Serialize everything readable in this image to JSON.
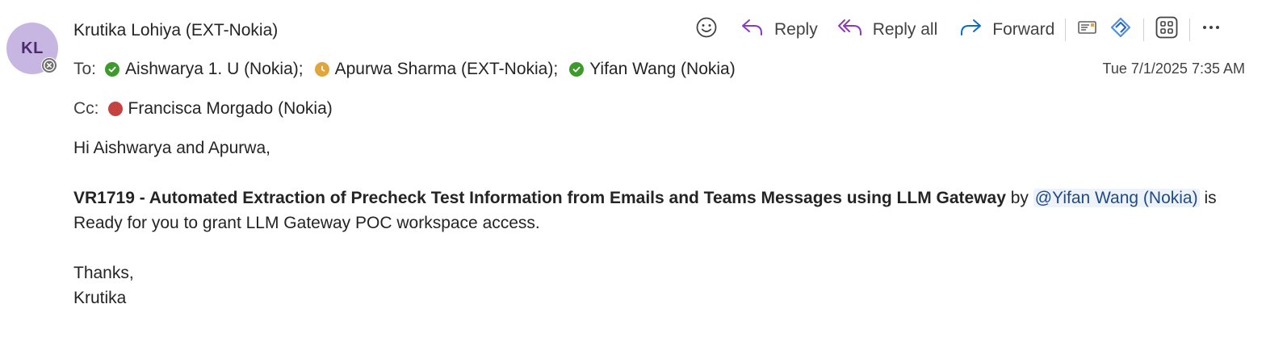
{
  "sender": {
    "initials": "KL",
    "name": "Krutika Lohiya (EXT-Nokia)"
  },
  "toolbar": {
    "reply": "Reply",
    "reply_all": "Reply all",
    "forward": "Forward",
    "icons": [
      "emoji-icon",
      "reply-icon",
      "reply-all-icon",
      "forward-icon",
      "message-header-icon",
      "loop-icon",
      "apps-icon",
      "more-icon"
    ]
  },
  "to": {
    "prefix": "To:",
    "recipients": [
      {
        "name": "Aishwarya 1. U (Nokia)",
        "separator": ";",
        "status": "available"
      },
      {
        "name": "Apurwa Sharma (EXT-Nokia)",
        "separator": ";",
        "status": "away"
      },
      {
        "name": "Yifan Wang (Nokia)",
        "separator": "",
        "status": "available"
      }
    ]
  },
  "cc": {
    "prefix": "Cc:",
    "recipients": [
      {
        "name": "Francisca Morgado (Nokia)",
        "status": "busy"
      }
    ]
  },
  "date": "Tue 7/1/2025 7:35 AM",
  "body": {
    "greeting": "Hi Aishwarya and Apurwa,",
    "subject_bold": "VR1719 - Automated Extraction of Precheck Test Information from Emails and Teams Messages using LLM Gateway",
    "by": " by ",
    "mention": "@Yifan Wang (Nokia)",
    "rest": " is Ready for you to grant LLM Gateway POC workspace access.",
    "closing": "Thanks,",
    "signature": "Krutika"
  },
  "colors": {
    "accent": "#0f6cbd",
    "reply_purple": "#8a3ab9",
    "available": "#3f9a2e",
    "away": "#e0a63b",
    "busy": "#c4423f",
    "avatar_bg": "#c8b6e2"
  }
}
